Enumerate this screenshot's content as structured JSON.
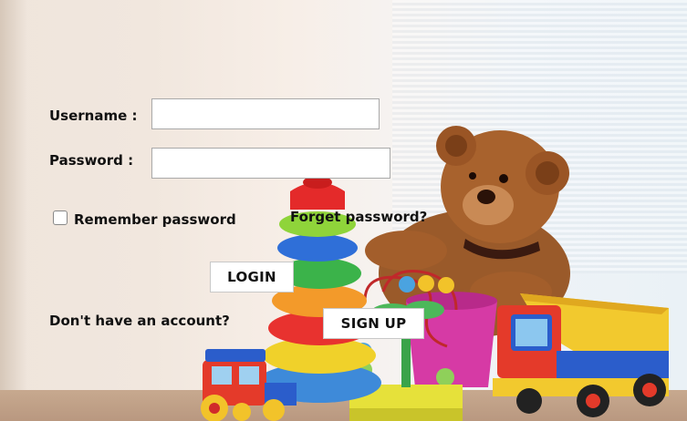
{
  "form": {
    "username_label": "Username :",
    "username_value": "",
    "password_label": "Password :",
    "password_value": "",
    "remember_label": "Remember password",
    "remember_checked": false,
    "forget_label": "Forget password?",
    "login_label": "LOGIN",
    "no_account_label": "Don't have an account?",
    "signup_label": "SIGN UP"
  },
  "background": {
    "description_icons": [
      "teddy-bear-icon",
      "ring-stacker-icon",
      "toy-truck-icon",
      "toy-train-icon",
      "bead-maze-icon"
    ]
  },
  "colors": {
    "text": "#111111",
    "button_bg": "#ffffff",
    "field_border": "#a9a9a9"
  }
}
